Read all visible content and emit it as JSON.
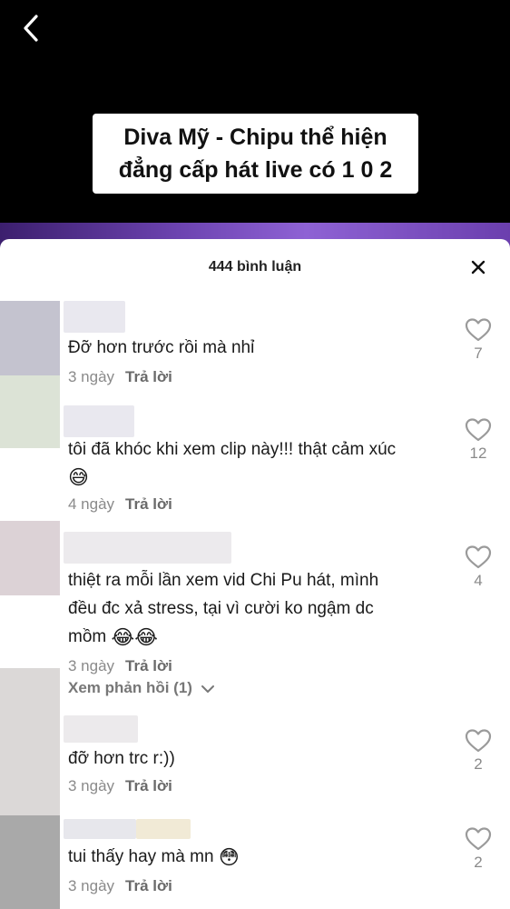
{
  "video": {
    "caption_line1": "Diva Mỹ - Chipu thể hiện",
    "caption_line2": "đẳng cấp hát live có 1 0 2"
  },
  "sheet": {
    "comment_count": "444 bình luận",
    "reply_label": "Trả lời"
  },
  "comments": [
    {
      "text": "Đỡ hơn trước rồi mà nhỉ",
      "time": "3 ngày",
      "likes": "7"
    },
    {
      "text": "tôi đã khóc khi xem clip này!!! thật cảm xúc",
      "emoji": "😅",
      "time": "4 ngày",
      "likes": "12"
    },
    {
      "text_line1": "thiệt ra mỗi lần xem vid Chi Pu hát, mình",
      "text_line2": "đều đc xả stress, tại vì cười ko ngậm dc",
      "text_line3": "mồm",
      "emoji": "😂😂",
      "time": "3 ngày",
      "likes": "4",
      "view_replies": "Xem phản hồi (1)"
    },
    {
      "text": "đỡ hơn trc r:))",
      "time": "3 ngày",
      "likes": "2"
    },
    {
      "text": "tui thấy hay mà mn",
      "emoji": "😳",
      "time": "3 ngày",
      "likes": "2"
    }
  ],
  "colors": {
    "video_bg": "#000000",
    "sheet_bg": "#ffffff",
    "meta_text": "#8a8a8a"
  },
  "icons": [
    "back-arrow-icon",
    "close-icon",
    "heart-outline-icon",
    "chevron-down-icon"
  ]
}
